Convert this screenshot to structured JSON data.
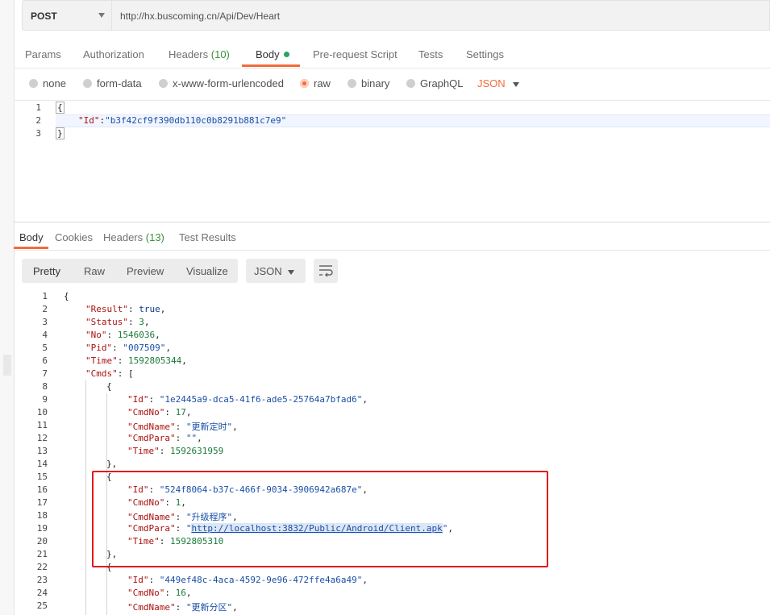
{
  "request": {
    "method": "POST",
    "url": "http://hx.buscoming.cn/Api/Dev/Heart"
  },
  "request_tabs": [
    {
      "label": "Params"
    },
    {
      "label": "Authorization"
    },
    {
      "label": "Headers",
      "count": "(10)"
    },
    {
      "label": "Body"
    },
    {
      "label": "Pre-request Script"
    },
    {
      "label": "Tests"
    },
    {
      "label": "Settings"
    }
  ],
  "body_types": [
    {
      "label": "none"
    },
    {
      "label": "form-data"
    },
    {
      "label": "x-www-form-urlencoded"
    },
    {
      "label": "raw"
    },
    {
      "label": "binary"
    },
    {
      "label": "GraphQL"
    }
  ],
  "body_format": "JSON",
  "request_body": [
    {
      "num": "1",
      "text": "{"
    },
    {
      "num": "2",
      "key": "\"Id\"",
      "value": "\"b3f42cf9f390db110c0b8291b881c7e9\""
    },
    {
      "num": "3",
      "text": "}"
    }
  ],
  "response_tabs": [
    {
      "label": "Body"
    },
    {
      "label": "Cookies"
    },
    {
      "label": "Headers",
      "count": "(13)"
    },
    {
      "label": "Test Results"
    }
  ],
  "response_views": [
    {
      "label": "Pretty"
    },
    {
      "label": "Raw"
    },
    {
      "label": "Preview"
    },
    {
      "label": "Visualize"
    }
  ],
  "response_format": "JSON",
  "response_lines": [
    {
      "num": "1",
      "text": "{"
    },
    {
      "num": "2",
      "key": "\"Result\"",
      "value": "true",
      "comma": ","
    },
    {
      "num": "3",
      "key": "\"Status\"",
      "value": "3",
      "comma": ","
    },
    {
      "num": "4",
      "key": "\"No\"",
      "value": "1546036",
      "comma": ","
    },
    {
      "num": "5",
      "key": "\"Pid\"",
      "value": "\"007509\"",
      "comma": ","
    },
    {
      "num": "6",
      "key": "\"Time\"",
      "value": "1592805344",
      "comma": ","
    },
    {
      "num": "7",
      "key": "\"Cmds\"",
      "value": "[",
      "comma": ""
    },
    {
      "num": "8",
      "text": "{"
    },
    {
      "num": "9",
      "key": "\"Id\"",
      "value": "\"1e2445a9-dca5-41f6-ade5-25764a7bfad6\"",
      "comma": ","
    },
    {
      "num": "10",
      "key": "\"CmdNo\"",
      "value": "17",
      "comma": ","
    },
    {
      "num": "11",
      "key": "\"CmdName\"",
      "value": "\"更新定时\"",
      "comma": ","
    },
    {
      "num": "12",
      "key": "\"CmdPara\"",
      "value": "\"\"",
      "comma": ","
    },
    {
      "num": "13",
      "key": "\"Time\"",
      "value": "1592631959",
      "comma": ""
    },
    {
      "num": "14",
      "text": "},"
    },
    {
      "num": "15",
      "text": "{"
    },
    {
      "num": "16",
      "key": "\"Id\"",
      "value": "\"524f8064-b37c-466f-9034-3906942a687e\"",
      "comma": ","
    },
    {
      "num": "17",
      "key": "\"CmdNo\"",
      "value": "1",
      "comma": ","
    },
    {
      "num": "18",
      "key": "\"CmdName\"",
      "value": "\"升级程序\"",
      "comma": ","
    },
    {
      "num": "19",
      "key": "\"CmdPara\"",
      "value": "\"http://localhost:3832/Public/Android/Client.apk\"",
      "comma": ","
    },
    {
      "num": "20",
      "key": "\"Time\"",
      "value": "1592805310",
      "comma": ""
    },
    {
      "num": "21",
      "text": "},"
    },
    {
      "num": "22",
      "text": "{"
    },
    {
      "num": "23",
      "key": "\"Id\"",
      "value": "\"449ef48c-4aca-4592-9e96-472ffe4a6a49\"",
      "comma": ","
    },
    {
      "num": "24",
      "key": "\"CmdNo\"",
      "value": "16",
      "comma": ","
    },
    {
      "num": "25",
      "key": "\"CmdName\"",
      "value": "\"更新分区\"",
      "comma": ","
    }
  ],
  "colors": {
    "accent": "#f26b3a",
    "highlight_box": "#e0191b",
    "status_dot": "#26a65b"
  }
}
